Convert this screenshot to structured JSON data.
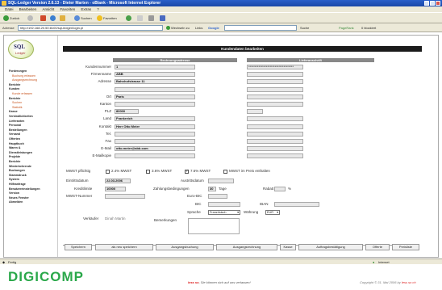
{
  "window": {
    "title": "SQL-Ledger Version 2.6.13 - Dieter Marten - oBlank - Microsoft Internet Explorer"
  },
  "menu": [
    "Datei",
    "Bearbeiten",
    "Ansicht",
    "Favoriten",
    "Extras",
    "?"
  ],
  "toolbar": {
    "back": "Zurück",
    "search": "Suchen",
    "favorites": "Favoriten"
  },
  "address": {
    "label": "Adresse",
    "url": "http://192.168.20.50:8100/sql-ledger/login.pl",
    "go": "Wechseln zu",
    "links": "Links",
    "google": "Google",
    "search_btn": "Suche",
    "pagerank": "PageRank",
    "blocked": "0 blockiert"
  },
  "logo": {
    "big": "SQL",
    "small": "Ledger"
  },
  "sidebar": [
    {
      "label": "Forderungen",
      "style": "b"
    },
    {
      "label": "Buchung erfassen",
      "style": "s"
    },
    {
      "label": "Ausgangsrechnung",
      "style": "s"
    },
    {
      "label": "Berichte",
      "style": "b"
    },
    {
      "label": "Kunden",
      "style": "b"
    },
    {
      "label": "Kunde erfassen",
      "style": "s"
    },
    {
      "label": "Berichte",
      "style": "b"
    },
    {
      "label": "Suchen",
      "style": "s"
    },
    {
      "label": "Statistik",
      "style": "s"
    },
    {
      "label": "Kasse",
      "style": "b"
    },
    {
      "label": "Verbindlichkeiten",
      "style": "b"
    },
    {
      "label": "Lieferanten",
      "style": "b"
    },
    {
      "label": "Personal",
      "style": "b"
    },
    {
      "label": "Bestellungen",
      "style": "b"
    },
    {
      "label": "Versand",
      "style": "b"
    },
    {
      "label": "Offerten",
      "style": "b"
    },
    {
      "label": "Hauptbuch",
      "style": "b"
    },
    {
      "label": "Waren &",
      "style": "b"
    },
    {
      "label": "Dienstleistungen",
      "style": "b"
    },
    {
      "label": "Projekte",
      "style": "b"
    },
    {
      "label": "Berichte",
      "style": "b"
    },
    {
      "label": "Wiederkehrende",
      "style": "b"
    },
    {
      "label": "Buchungen",
      "style": "b"
    },
    {
      "label": "Stammdruck",
      "style": "b"
    },
    {
      "label": "System",
      "style": "b"
    },
    {
      "label": "Hilfeanfrage",
      "style": "b"
    },
    {
      "label": "Benutzereinstellungen",
      "style": "b"
    },
    {
      "label": "Version",
      "style": "b"
    },
    {
      "label": "Neues Fenster",
      "style": "b"
    },
    {
      "label": "Abmelden",
      "style": "b"
    }
  ],
  "form": {
    "header": "Kundendaten bearbeiten",
    "billing_header": "Rechnungsadresse",
    "shipping_header": "Lieferanschrift",
    "fields": [
      {
        "label": "Kundennummer",
        "value": "1"
      },
      {
        "label": "Firmenname",
        "value": "ABB"
      },
      {
        "label": "Adresse",
        "value": "Bahnhofstrasse 11"
      },
      {
        "label": "",
        "value": ""
      },
      {
        "label": "Ort",
        "value": "Paris"
      },
      {
        "label": "Kanton",
        "value": ""
      },
      {
        "label": "PLZ",
        "value": "80000"
      },
      {
        "label": "Land",
        "value": "Frankreich"
      },
      {
        "label": "Kontakt",
        "value": "Herr Otto Meier"
      },
      {
        "label": "Tel.",
        "value": ""
      },
      {
        "label": "Fax",
        "value": ""
      },
      {
        "label": "E-Mail",
        "value": "otto.meier@abb.com"
      },
      {
        "label": "E-Mailkopie",
        "value": ""
      }
    ],
    "shipping_value": "************************************",
    "vat": {
      "label": "MWST pflichtig",
      "opt1": "2.4% MWST",
      "opt2": "3.6% MWST",
      "opt3": "7.6% MWST",
      "opt4": "MWST im Preis enthalten"
    },
    "eintritt": {
      "label": "Eintrittsdatum",
      "value": "22.03.2006"
    },
    "austritt": {
      "label": "Austrittsdatum",
      "value": ""
    },
    "kredit": {
      "label": "Kreditlimite",
      "value": "10000"
    },
    "zahlung": {
      "label": "Zahlungsbedingungen",
      "value": "30",
      "unit": "Tage"
    },
    "rabatt": {
      "label": "Rabatt",
      "unit": "%"
    },
    "mwst_nr": {
      "label": "MWST-Nummer"
    },
    "euro_bic": {
      "label": "Euro-BIC"
    },
    "bic": {
      "label": "BIC"
    },
    "iban": {
      "label": "IBAN"
    },
    "sprache": {
      "label": "Sprache",
      "value": "Französisch"
    },
    "waehrung": {
      "label": "Währung",
      "value": "EUR"
    },
    "verkaeufer": {
      "label": "Verkäufer",
      "value": "Dinah Martin"
    },
    "bemerkungen": {
      "label": "Bemerkungen"
    }
  },
  "buttons": [
    "Speichern",
    "als neu speichern",
    "Ausgangsbuchung",
    "Ausgangsrechnung",
    "Kasse",
    "Auftragsbestätigung",
    "Offerte",
    "Preisliste"
  ],
  "status": {
    "left": "Fertig",
    "right": "Internet"
  },
  "brand": "DIGICOMP",
  "caption": {
    "keyword": "less so",
    "text": ", Sie können sich auf uns verlassen!"
  },
  "copyright": {
    "text": "Copyright © 31. Mai 2006 by ",
    "keyword": "less so ch"
  }
}
